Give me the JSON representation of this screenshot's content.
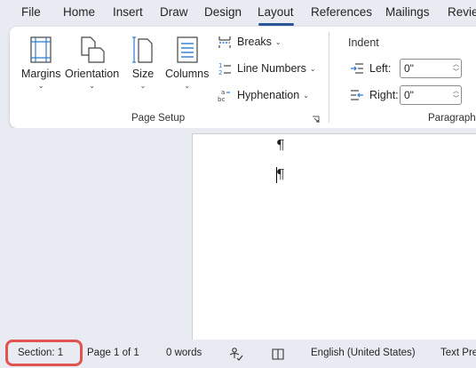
{
  "menu": {
    "tabs": [
      {
        "label": "File"
      },
      {
        "label": "Home"
      },
      {
        "label": "Insert"
      },
      {
        "label": "Draw"
      },
      {
        "label": "Design"
      },
      {
        "label": "Layout"
      },
      {
        "label": "References"
      },
      {
        "label": "Mailings"
      },
      {
        "label": "Revie"
      }
    ],
    "active_tab": "Layout",
    "accent_color": "#2b579a"
  },
  "ribbon": {
    "page_setup": {
      "margins": "Margins",
      "orientation": "Orientation",
      "size": "Size",
      "columns": "Columns",
      "breaks": "Breaks",
      "line_numbers": "Line Numbers",
      "hyphenation": "Hyphenation",
      "group_label": "Page Setup"
    },
    "paragraph": {
      "indent_label": "Indent",
      "left_label": "Left:",
      "left_value": "0\"",
      "right_label": "Right:",
      "right_value": "0\"",
      "group_label": "Paragraph"
    }
  },
  "document": {
    "marks": [
      "¶",
      "¶"
    ]
  },
  "status": {
    "section": "Section: 1",
    "page": "Page 1 of 1",
    "words": "0 words",
    "language": "English (United States)",
    "text_predictions": "Text Pred",
    "highlight_color": "#e0544d"
  }
}
